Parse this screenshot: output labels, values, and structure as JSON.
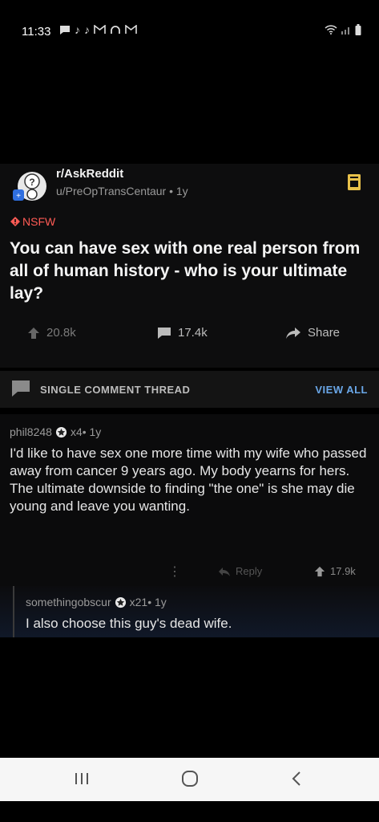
{
  "status_bar": {
    "time": "11:33",
    "notification_icons": [
      "chat-icon",
      "tiktok-icon",
      "tiktok-icon",
      "gmail-icon",
      "headset-icon",
      "gmail-icon"
    ],
    "status_icons": [
      "wifi-icon",
      "signal-icon",
      "battery-icon"
    ]
  },
  "post": {
    "subreddit": "r/AskReddit",
    "author_meta": "u/PreOpTransCentaur • 1y",
    "nsfw_label": "NSFW",
    "title": "You can have sex with one real person from all of human history - who is your ultimate lay?",
    "upvotes": "20.8k",
    "comments": "17.4k",
    "share_label": "Share"
  },
  "thread_bar": {
    "label": "SINGLE COMMENT THREAD",
    "view_all": "VIEW ALL"
  },
  "comment1": {
    "author": "phil8248",
    "meta": "x4• 1y",
    "body": "I'd like to have sex one more time with my wife who passed away from cancer 9 years ago. My body yearns for hers. The ultimate downside to finding \"the one\" is she may die young and leave you wanting.",
    "reply_label": "Reply",
    "upvotes": "17.9k"
  },
  "comment2": {
    "author": "somethingobscur",
    "meta": "x21• 1y",
    "body": "I also choose this guy's dead wife."
  },
  "colors": {
    "nsfw": "#ff5b55",
    "link_blue": "#6aa7e8",
    "background": "#000000"
  }
}
